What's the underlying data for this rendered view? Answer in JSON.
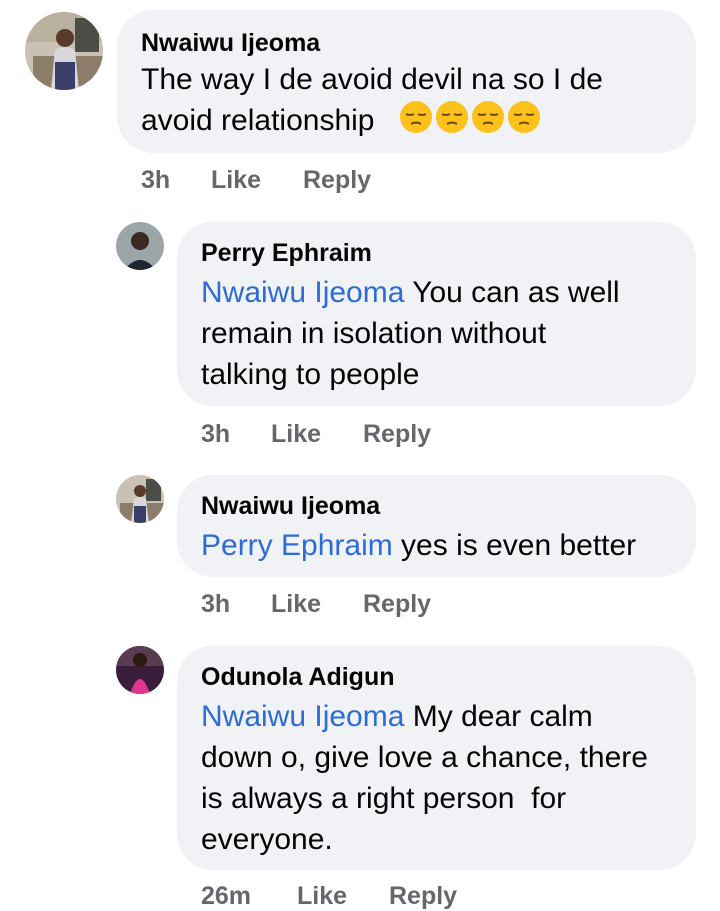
{
  "comments": [
    {
      "author": "Nwaiwu Ijeoma",
      "mention": "",
      "text_lines": [
        "The way I de avoid devil na so I de",
        "avoid relationship"
      ],
      "emoji_count": 4,
      "time": "3h",
      "like": "Like",
      "reply": "Reply",
      "avatar_icon": "woman-profile-photo-icon"
    },
    {
      "author": "Perry Ephraim",
      "mention": "Nwaiwu Ijeoma",
      "text_lines": [
        " You can as well",
        "remain in isolation without",
        "talking to people"
      ],
      "time": "3h",
      "like": "Like",
      "reply": "Reply",
      "avatar_icon": "man-profile-photo-icon"
    },
    {
      "author": "Nwaiwu Ijeoma",
      "mention": "Perry Ephraim",
      "text_lines": [
        " yes is even better"
      ],
      "time": "3h",
      "like": "Like",
      "reply": "Reply",
      "avatar_icon": "woman-profile-photo-icon"
    },
    {
      "author": "Odunola Adigun",
      "mention": "Nwaiwu Ijeoma",
      "text_lines": [
        " My dear calm",
        "down o, give love a chance, there",
        "is always a right person  for",
        "everyone."
      ],
      "time": "26m",
      "like": "Like",
      "reply": "Reply",
      "avatar_icon": "woman-pink-dress-photo-icon"
    }
  ],
  "colors": {
    "bubble": "#f0f2f5",
    "mention": "#2d6bd6",
    "meta": "#65676b",
    "text": "#050505"
  }
}
